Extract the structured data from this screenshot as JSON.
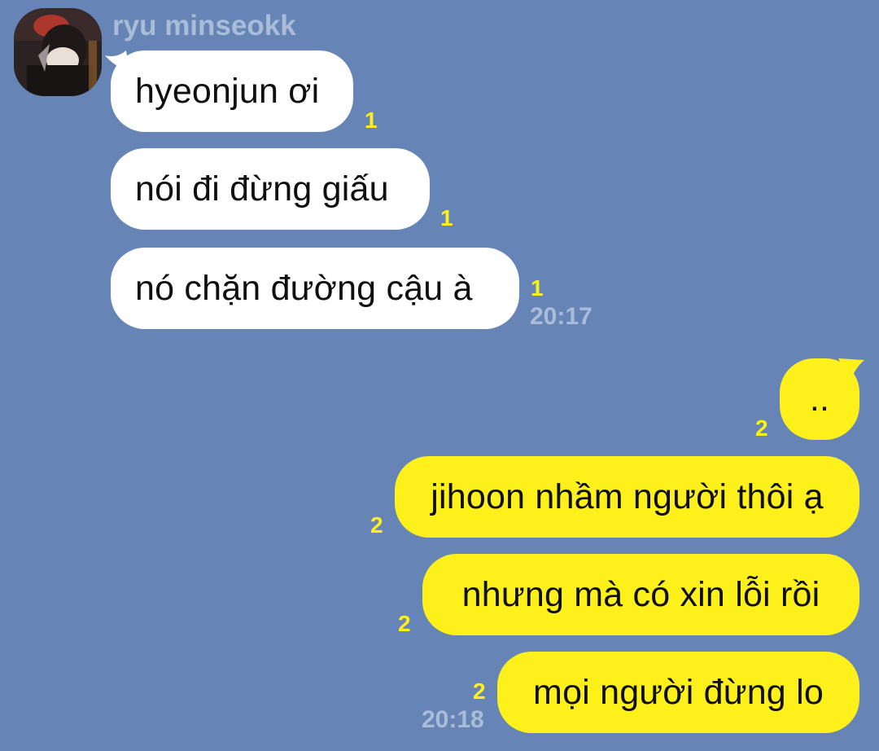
{
  "chat": {
    "sender_name": "ryu minseokk",
    "incoming": [
      {
        "text": "hyeonjun ơi",
        "unread": "1"
      },
      {
        "text": "nói đi đừng giấu",
        "unread": "1"
      },
      {
        "text": "nó chặn đường cậu à",
        "unread": "1",
        "time": "20:17"
      }
    ],
    "outgoing": [
      {
        "text": "..",
        "unread": "2"
      },
      {
        "text": "jihoon nhầm người thôi ạ",
        "unread": "2"
      },
      {
        "text": "nhưng mà có xin lỗi rồi",
        "unread": "2"
      },
      {
        "text": "mọi người đừng lo",
        "unread": "2",
        "time": "20:18"
      }
    ]
  },
  "colors": {
    "background": "#6685b6",
    "incoming_bubble": "#ffffff",
    "outgoing_bubble": "#fef01b",
    "unread_count": "#fef01b",
    "meta_text": "#a9bcd8"
  }
}
